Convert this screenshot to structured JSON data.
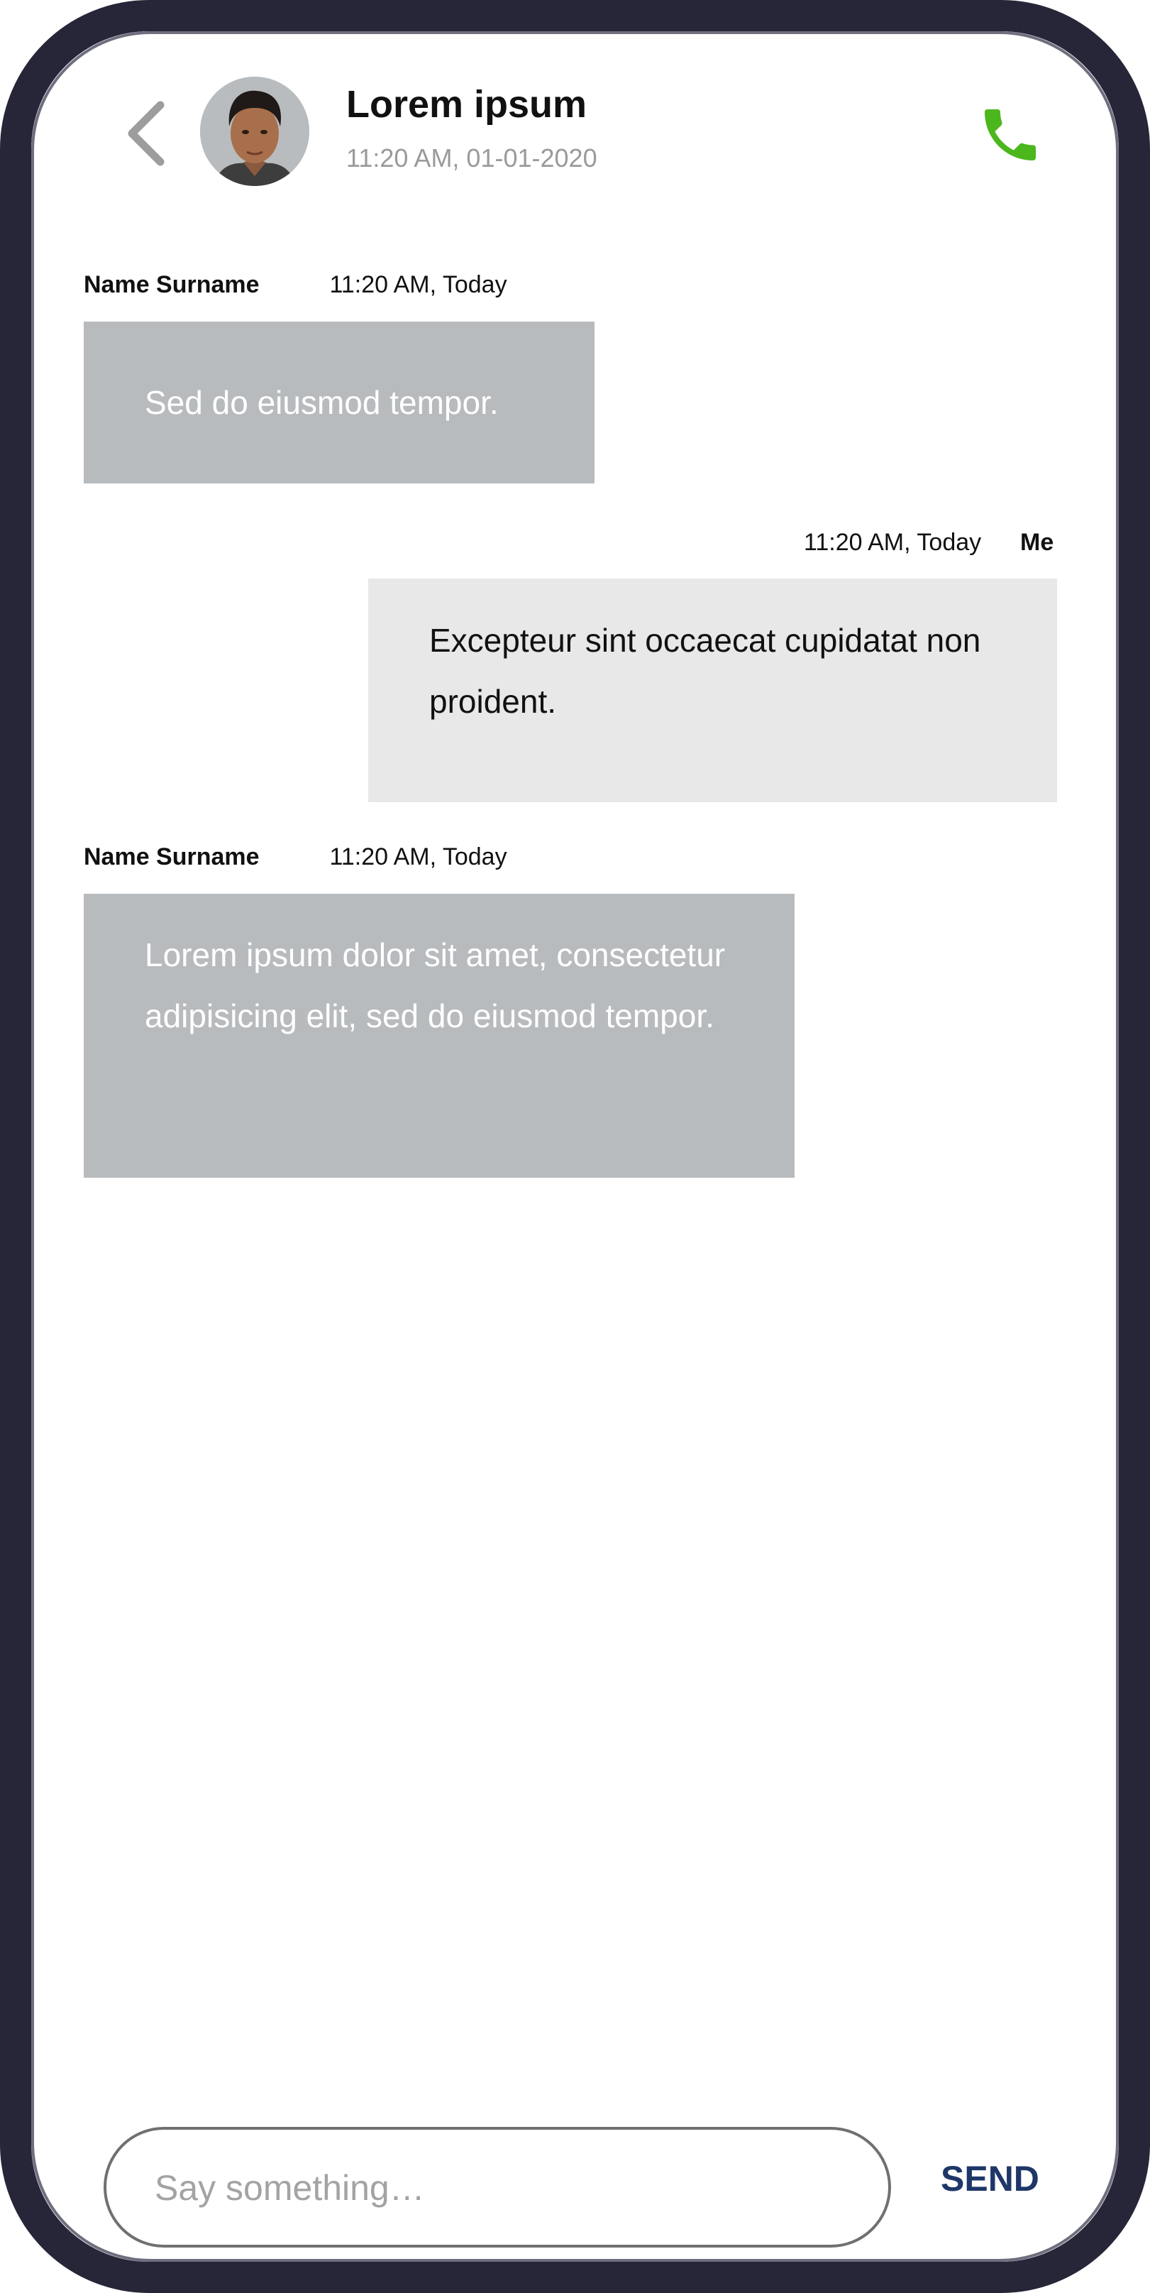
{
  "header": {
    "contact_name": "Lorem ipsum",
    "contact_status": "11:20 AM, 01-01-2020",
    "back_icon": "chevron-left-icon",
    "call_icon": "phone-icon",
    "call_icon_color": "#4cb71d"
  },
  "messages": [
    {
      "sender": "Name Surname",
      "time": "11:20 AM, Today",
      "text": "Sed do eiusmod tempor.",
      "direction": "incoming"
    },
    {
      "sender": "Me",
      "time": "11:20 AM, Today",
      "text": "Excepteur sint occaecat cupidatat non proident.",
      "direction": "outgoing"
    },
    {
      "sender": "Name Surname",
      "time": "11:20 AM, Today",
      "text": "Lorem ipsum dolor sit amet, consectetur adipisicing elit, sed do eiusmod tempor.",
      "direction": "incoming"
    }
  ],
  "composer": {
    "placeholder": "Say something…",
    "value": "",
    "send_label": "SEND",
    "send_color": "#1e3768"
  },
  "colors": {
    "frame": "#262638",
    "incoming_bubble": "#b8bbbe",
    "outgoing_bubble": "#e8e8e8"
  }
}
